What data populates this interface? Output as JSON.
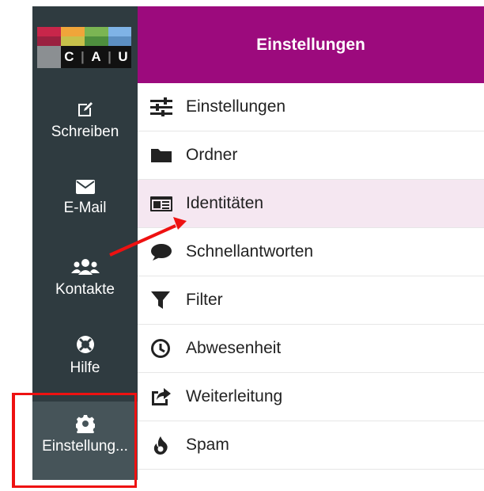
{
  "header": {
    "title": "Einstellungen"
  },
  "logo": {
    "text": "CAU",
    "letters": [
      "C",
      "A",
      "U"
    ]
  },
  "sidebar": {
    "items": [
      {
        "label": "Schreiben",
        "icon": "edit-icon"
      },
      {
        "label": "E-Mail",
        "icon": "envelope-icon"
      },
      {
        "label": "Kontakte",
        "icon": "users-icon"
      },
      {
        "label": "Hilfe",
        "icon": "lifebuoy-icon"
      },
      {
        "label": "Einstellung...",
        "icon": "gear-icon"
      }
    ]
  },
  "settings_list": {
    "items": [
      {
        "label": "Einstellungen",
        "icon": "sliders-icon"
      },
      {
        "label": "Ordner",
        "icon": "folder-icon"
      },
      {
        "label": "Identitäten",
        "icon": "id-card-icon"
      },
      {
        "label": "Schnellantworten",
        "icon": "comment-icon"
      },
      {
        "label": "Filter",
        "icon": "filter-icon"
      },
      {
        "label": "Abwesenheit",
        "icon": "clock-icon"
      },
      {
        "label": "Weiterleitung",
        "icon": "share-icon"
      },
      {
        "label": "Spam",
        "icon": "fire-icon"
      }
    ]
  },
  "colors": {
    "sidebar": "#2f3b40",
    "header": "#9c0a7d",
    "selected_row": "#f5e7f1",
    "annotation": "#ee1111"
  }
}
